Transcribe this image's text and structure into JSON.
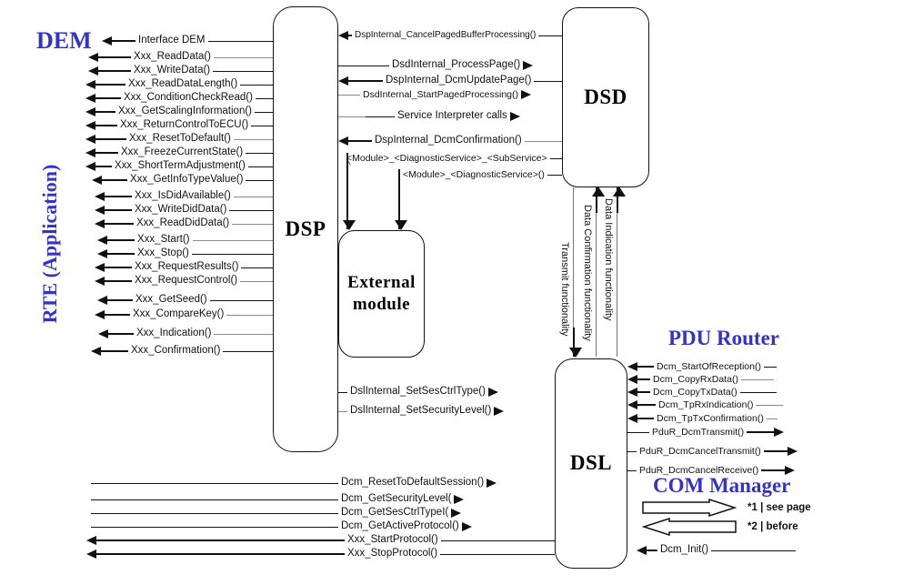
{
  "diagram": {
    "modules": {
      "dsp": "DSP",
      "dsd": "DSD",
      "dsl": "DSL",
      "external_line1": "External",
      "external_line2": "module"
    },
    "headings": {
      "dem": "DEM",
      "rte": "RTE (Application)",
      "pdu_router": "PDU Router",
      "com_manager": "COM Manager"
    },
    "accent_color": "#3333CC",
    "rte_to_dsp": [
      {
        "label": "Interface DEM"
      },
      {
        "label": "Xxx_ReadData()"
      },
      {
        "label": "Xxx_WriteData()"
      },
      {
        "label": "Xxx_ReadDataLength()"
      },
      {
        "label": "Xxx_ConditionCheckRead()"
      },
      {
        "label": "Xxx_GetScalingInformation()"
      },
      {
        "label": "Xxx_ReturnControlToECU()"
      },
      {
        "label": "Xxx_ResetToDefault()"
      },
      {
        "label": "Xxx_FreezeCurrentState()"
      },
      {
        "label": "Xxx_ShortTermAdjustment()"
      },
      {
        "label": "Xxx_GetInfoTypeValue()"
      },
      {
        "label": "Xxx_IsDidAvailable()"
      },
      {
        "label": "Xxx_WriteDidData()"
      },
      {
        "label": "Xxx_ReadDidData()"
      },
      {
        "label": "Xxx_Start()"
      },
      {
        "label": "Xxx_Stop()"
      },
      {
        "label": "Xxx_RequestResults()"
      },
      {
        "label": "Xxx_RequestControl()"
      },
      {
        "label": "Xxx_GetSeed()"
      },
      {
        "label": "Xxx_CompareKey()"
      },
      {
        "label": "Xxx_Indication()"
      },
      {
        "label": "Xxx_Confirmation()"
      }
    ],
    "dsp_dsd": [
      {
        "label": "DspInternal_CancelPagedBufferProcessing()",
        "direction": "left"
      },
      {
        "label": "DsdInternal_ProcessPage()",
        "direction": "right"
      },
      {
        "label": "DspInternal_DcmUpdatePage()",
        "direction": "left"
      },
      {
        "label": "DsdInternal_StartPagedProcessing()",
        "direction": "right"
      },
      {
        "label": "Service Interpreter calls",
        "direction": "right"
      },
      {
        "label": "DspInternal_DcmConfirmation()",
        "direction": "left"
      }
    ],
    "dsp_external": [
      {
        "label": "<Module>_<DiagnosticService>_<SubService>",
        "marker": "^"
      },
      {
        "label": "<Module>_<DiagnosticService>()"
      }
    ],
    "dsd_dsl_vertical": [
      {
        "label": "Transmit functionality",
        "direction": "down"
      },
      {
        "label": "Data Confirmation functionality",
        "direction": "up"
      },
      {
        "label": "Data Indication functionality",
        "direction": "up"
      }
    ],
    "dsp_dsl": [
      {
        "label": "DslInternal_SetSesCtrlType()",
        "direction": "right"
      },
      {
        "label": "DslInternal_SetSecurityLevel()",
        "direction": "right"
      }
    ],
    "rte_to_dsl": [
      {
        "label": "Dcm_ResetToDefaultSession()",
        "direction": "right"
      },
      {
        "label": "Dcm_GetSecurityLevel(",
        "direction": "right"
      },
      {
        "label": "Dcm_GetSesCtrlTypeI(",
        "direction": "right"
      },
      {
        "label": "Dcm_GetActiveProtocol()",
        "direction": "right"
      },
      {
        "label": "Xxx_StartProtocol()",
        "direction": "left"
      },
      {
        "label": "Xxx_StopProtocol()",
        "direction": "left"
      }
    ],
    "pdu_router_rows": [
      {
        "label": "Dcm_StartOfReception()",
        "direction": "left"
      },
      {
        "label": "Dcm_CopyRxData()",
        "direction": "left"
      },
      {
        "label": "Dcm_CopyTxData()",
        "direction": "left"
      },
      {
        "label": "Dcm_TpRxIndication()",
        "direction": "left"
      },
      {
        "label": "Dcm_TpTxConfirmation()",
        "direction": "left"
      },
      {
        "label": "PduR_DcmTransmit()",
        "direction": "right"
      },
      {
        "label": "PduR_DcmCancelTransmit()",
        "direction": "right"
      },
      {
        "label": "PduR_DcmCancelReceive()",
        "direction": "right"
      }
    ],
    "com_manager_rows": [
      {
        "label": "Dcm_Init()",
        "direction": "left"
      }
    ],
    "legend": [
      {
        "note": "*1 | see page",
        "direction": "right"
      },
      {
        "note": "*2 | before",
        "direction": "left"
      }
    ]
  }
}
